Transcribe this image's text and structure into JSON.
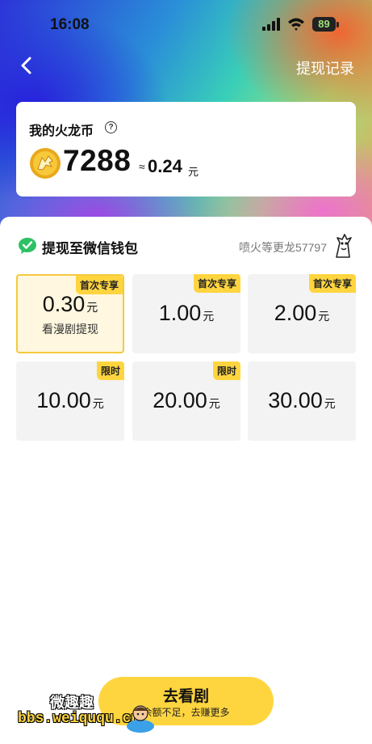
{
  "status_bar": {
    "time": "16:08",
    "battery": "89"
  },
  "nav": {
    "record_label": "提现记录"
  },
  "coin_card": {
    "title": "我的火龙币",
    "help_symbol": "?",
    "amount": "7288",
    "approx_symbol": "≈",
    "yuan_value": "0.24",
    "yuan_unit": "元"
  },
  "withdraw": {
    "title": "提现至微信钱包",
    "level_text": "喷火等更龙57797",
    "options": [
      {
        "amount": "0.30",
        "unit": "元",
        "badge": "首次专享",
        "note": "看漫剧提现",
        "selected": true
      },
      {
        "amount": "1.00",
        "unit": "元",
        "badge": "首次专享",
        "note": "",
        "selected": false
      },
      {
        "amount": "2.00",
        "unit": "元",
        "badge": "首次专享",
        "note": "",
        "selected": false
      },
      {
        "amount": "10.00",
        "unit": "元",
        "badge": "限时",
        "note": "",
        "selected": false
      },
      {
        "amount": "20.00",
        "unit": "元",
        "badge": "限时",
        "note": "",
        "selected": false
      },
      {
        "amount": "30.00",
        "unit": "元",
        "badge": "",
        "note": "",
        "selected": false
      }
    ]
  },
  "action_button": {
    "label": "去看剧",
    "sublabel": "余额不足，去赚更多"
  },
  "watermark": {
    "line1": "微趣趣",
    "line2": "bbs.weiququ.cn"
  },
  "colors": {
    "accent_yellow": "#ffd53f",
    "wechat_green": "#2dc163"
  }
}
